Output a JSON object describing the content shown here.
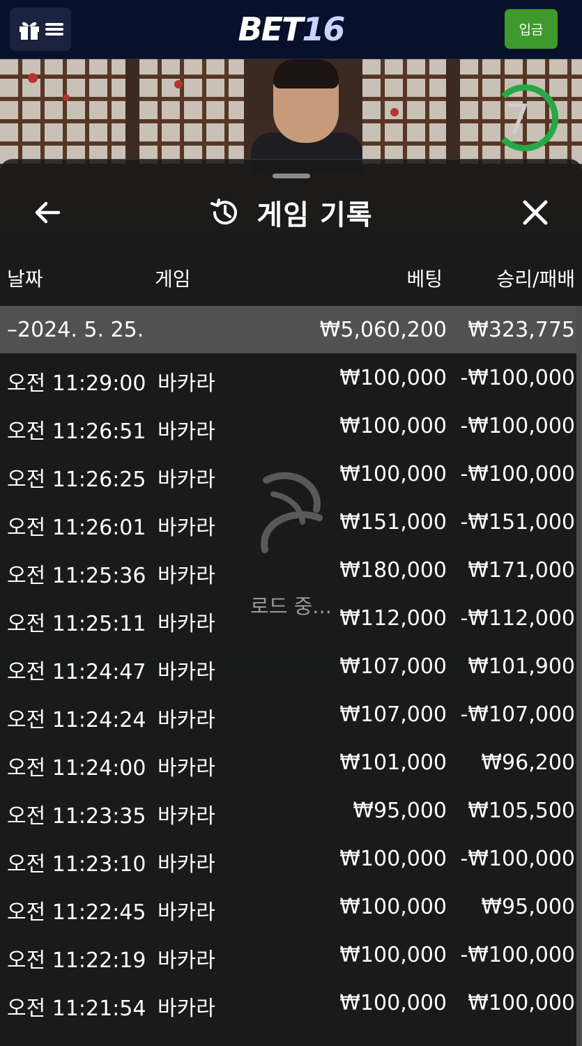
{
  "header": {
    "brand_prefix": "BET",
    "brand_number": "16",
    "deposit_label": "입금"
  },
  "video": {
    "timer_value": "7",
    "timer_color": "#28a745"
  },
  "panel": {
    "title": "게임 기록",
    "icons": [
      "back-arrow-icon",
      "history-icon",
      "close-icon"
    ],
    "columns": {
      "date": "날짜",
      "game": "게임",
      "bet": "베팅",
      "result": "승리/패배"
    },
    "summary": {
      "date": "–2024. 5. 25.",
      "bet_total": "₩5,060,200",
      "result_total": "₩323,775"
    },
    "rows": [
      {
        "time": "오전 11:29:00",
        "game": "바카라",
        "bet": "₩100,000",
        "result": "-₩100,000"
      },
      {
        "time": "오전 11:26:51",
        "game": "바카라",
        "bet": "₩100,000",
        "result": "-₩100,000"
      },
      {
        "time": "오전 11:26:25",
        "game": "바카라",
        "bet": "₩100,000",
        "result": "-₩100,000"
      },
      {
        "time": "오전 11:26:01",
        "game": "바카라",
        "bet": "₩151,000",
        "result": "-₩151,000"
      },
      {
        "time": "오전 11:25:36",
        "game": "바카라",
        "bet": "₩180,000",
        "result": "₩171,000"
      },
      {
        "time": "오전 11:25:11",
        "game": "바카라",
        "bet": "₩112,000",
        "result": "-₩112,000"
      },
      {
        "time": "오전 11:24:47",
        "game": "바카라",
        "bet": "₩107,000",
        "result": "₩101,900"
      },
      {
        "time": "오전 11:24:24",
        "game": "바카라",
        "bet": "₩107,000",
        "result": "-₩107,000"
      },
      {
        "time": "오전 11:24:00",
        "game": "바카라",
        "bet": "₩101,000",
        "result": "₩96,200"
      },
      {
        "time": "오전 11:23:35",
        "game": "바카라",
        "bet": "₩95,000",
        "result": "₩105,500"
      },
      {
        "time": "오전 11:23:10",
        "game": "바카라",
        "bet": "₩100,000",
        "result": "-₩100,000"
      },
      {
        "time": "오전 11:22:45",
        "game": "바카라",
        "bet": "₩100,000",
        "result": "₩95,000"
      },
      {
        "time": "오전 11:22:19",
        "game": "바카라",
        "bet": "₩100,000",
        "result": "-₩100,000"
      },
      {
        "time": "오전 11:21:54",
        "game": "바카라",
        "bet": "₩100,000",
        "result": "₩100,000"
      }
    ],
    "loading_text": "로드 중..."
  }
}
